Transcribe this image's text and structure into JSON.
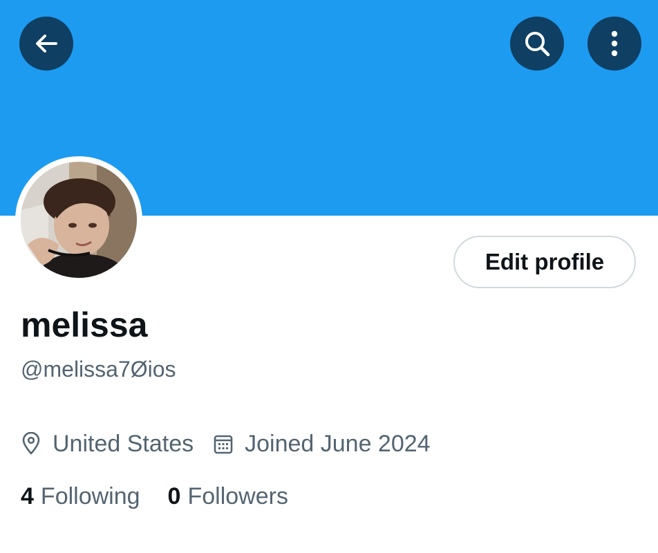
{
  "header": {
    "back_icon": "arrow-left-icon",
    "search_icon": "search-icon",
    "more_icon": "more-vertical-icon",
    "banner_color": "#1d9bf0",
    "button_color": "#0f3f63"
  },
  "profile": {
    "avatar": "profile-photo",
    "edit_button_label": "Edit profile",
    "display_name": "melissa",
    "handle": "@melissa7Øios",
    "location_icon": "location-pin-icon",
    "location": "United States",
    "joined_icon": "calendar-icon",
    "joined": "Joined June 2024",
    "following_count": "4",
    "following_label": "Following",
    "followers_count": "0",
    "followers_label": "Followers"
  }
}
